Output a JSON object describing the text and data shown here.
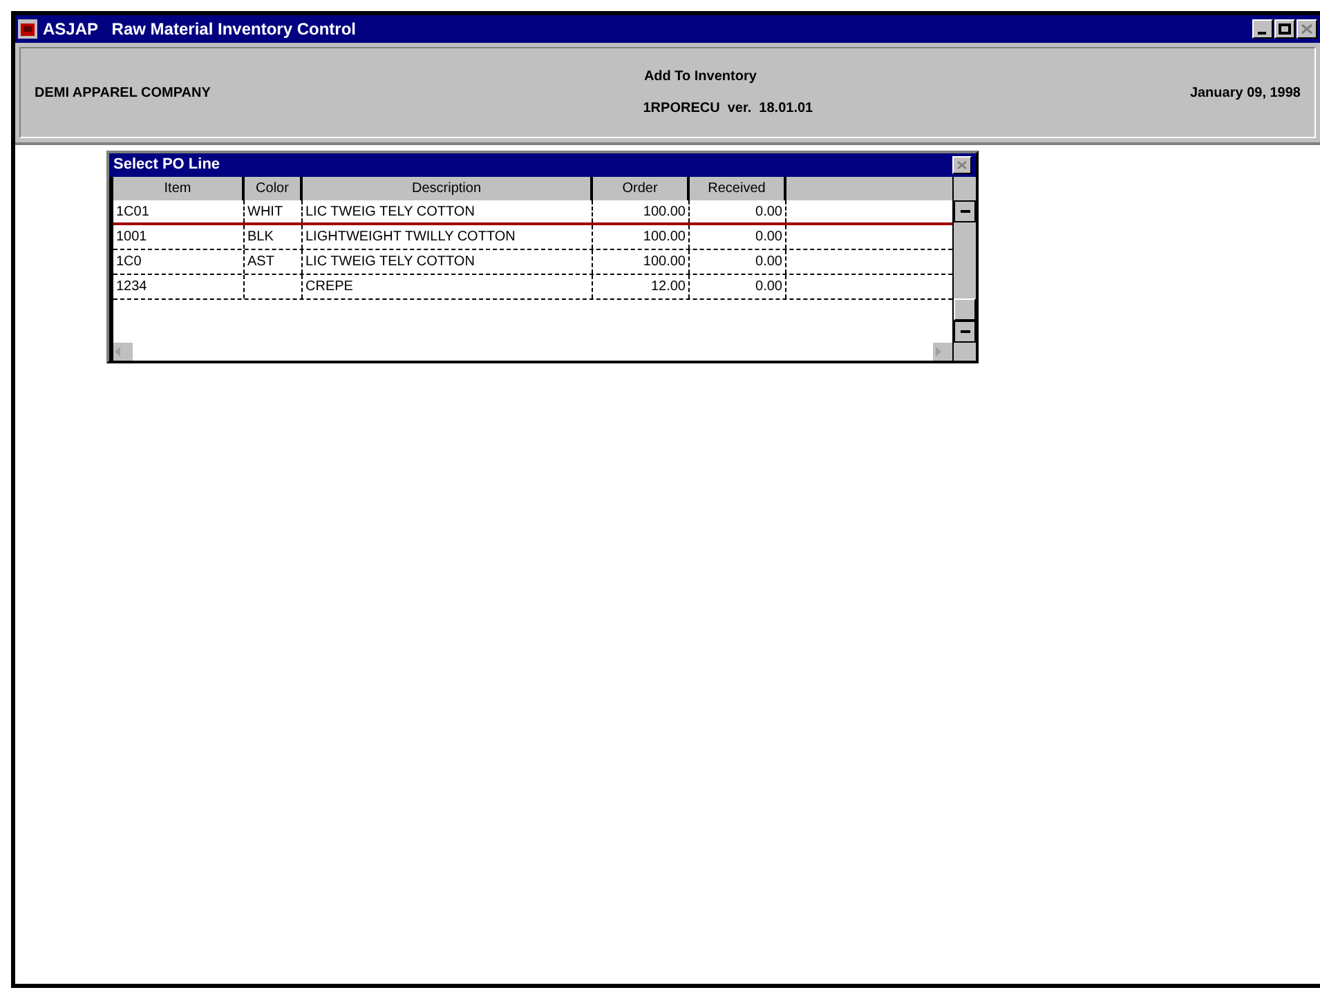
{
  "window": {
    "title": "ASJAP   Raw Material Inventory Control"
  },
  "header": {
    "company": "DEMI APPAREL COMPANY",
    "screen_title": "Add To Inventory",
    "program": "1RPORECU  ver.  18.01.01",
    "date": "January 09, 1998"
  },
  "dialog": {
    "title": "Select PO Line",
    "columns": [
      "Item",
      "Color",
      "Description",
      "Order",
      "Received"
    ],
    "rows": [
      {
        "cells": [
          "1C01",
          "WHIT",
          "LIC TWEIG TELY COTTON",
          "100.00",
          "0.00"
        ],
        "selected": true
      },
      {
        "cells": [
          "1001",
          "BLK",
          "LIGHTWEIGHT TWILLY COTTON",
          "100.00",
          "0.00"
        ],
        "selected": false
      },
      {
        "cells": [
          "1C0",
          "AST",
          "LIC TWEIG TELY COTTON",
          "100.00",
          "0.00"
        ],
        "selected": false
      },
      {
        "cells": [
          "1234",
          "",
          "CREPE",
          "12.00",
          "0.00"
        ],
        "selected": false
      }
    ]
  }
}
